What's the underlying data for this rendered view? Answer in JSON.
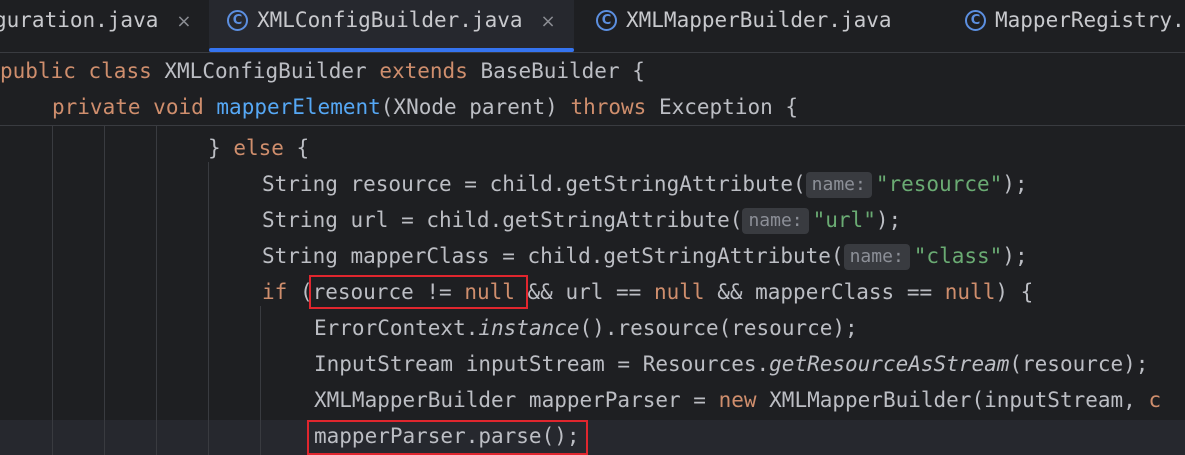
{
  "tabs": [
    {
      "label": "guration.java",
      "close": "×",
      "active": false
    },
    {
      "label": "XMLConfigBuilder.java",
      "icon": "C",
      "close": "×",
      "active": true
    },
    {
      "label": "XMLMapperBuilder.java",
      "icon": "C",
      "active": false
    },
    {
      "label": "MapperRegistry.",
      "icon": "C",
      "active": false
    }
  ],
  "sticky": {
    "line1": {
      "kw1": "public",
      "kw2": "class",
      "cls": "XMLConfigBuilder",
      "kw3": "extends",
      "base": "BaseBuilder",
      "brace": "{"
    },
    "line2": {
      "kw1": "private",
      "kw2": "void",
      "method": "mapperElement",
      "params": "(XNode parent)",
      "kw3": "throws",
      "exc": "Exception {"
    }
  },
  "code": {
    "l1": {
      "brace": "}",
      "kw": "else",
      "rest": "{"
    },
    "l2": {
      "pre": "String resource = child.getStringAttribute(",
      "hint": "name:",
      "str": "\"resource\"",
      "post": ");"
    },
    "l3": {
      "pre": "String url = child.getStringAttribute(",
      "hint": "name:",
      "str": "\"url\"",
      "post": ");"
    },
    "l4": {
      "pre": "String mapperClass = child.getStringAttribute(",
      "hint": "name:",
      "str": "\"class\"",
      "post": ");"
    },
    "l5": {
      "kw_if": "if",
      "p1": " (resource != ",
      "null1": "null",
      "p2": " && url == ",
      "null2": "null",
      "p3": " && mapperClass == ",
      "null3": "null",
      "p4": ") {"
    },
    "l6": {
      "pre": "ErrorContext.",
      "it": "instance",
      "post": "().resource(resource);"
    },
    "l7": {
      "pre": "InputStream inputStream = Resources.",
      "it": "getResourceAsStream",
      "post": "(resource);"
    },
    "l8": {
      "pre": "XMLMapperBuilder mapperParser = ",
      "kw": "new",
      "post": " XMLMapperBuilder(inputStream, ",
      "tail": "c"
    },
    "l9": {
      "text": "mapperParser.parse();"
    }
  },
  "colors": {
    "background": "#1e1f22",
    "keyword": "#cf8e6d",
    "method": "#56a8f5",
    "string": "#6aab73",
    "text": "#bcbec4",
    "highlight_box": "#e0262e",
    "tab_underline": "#3574f0"
  }
}
